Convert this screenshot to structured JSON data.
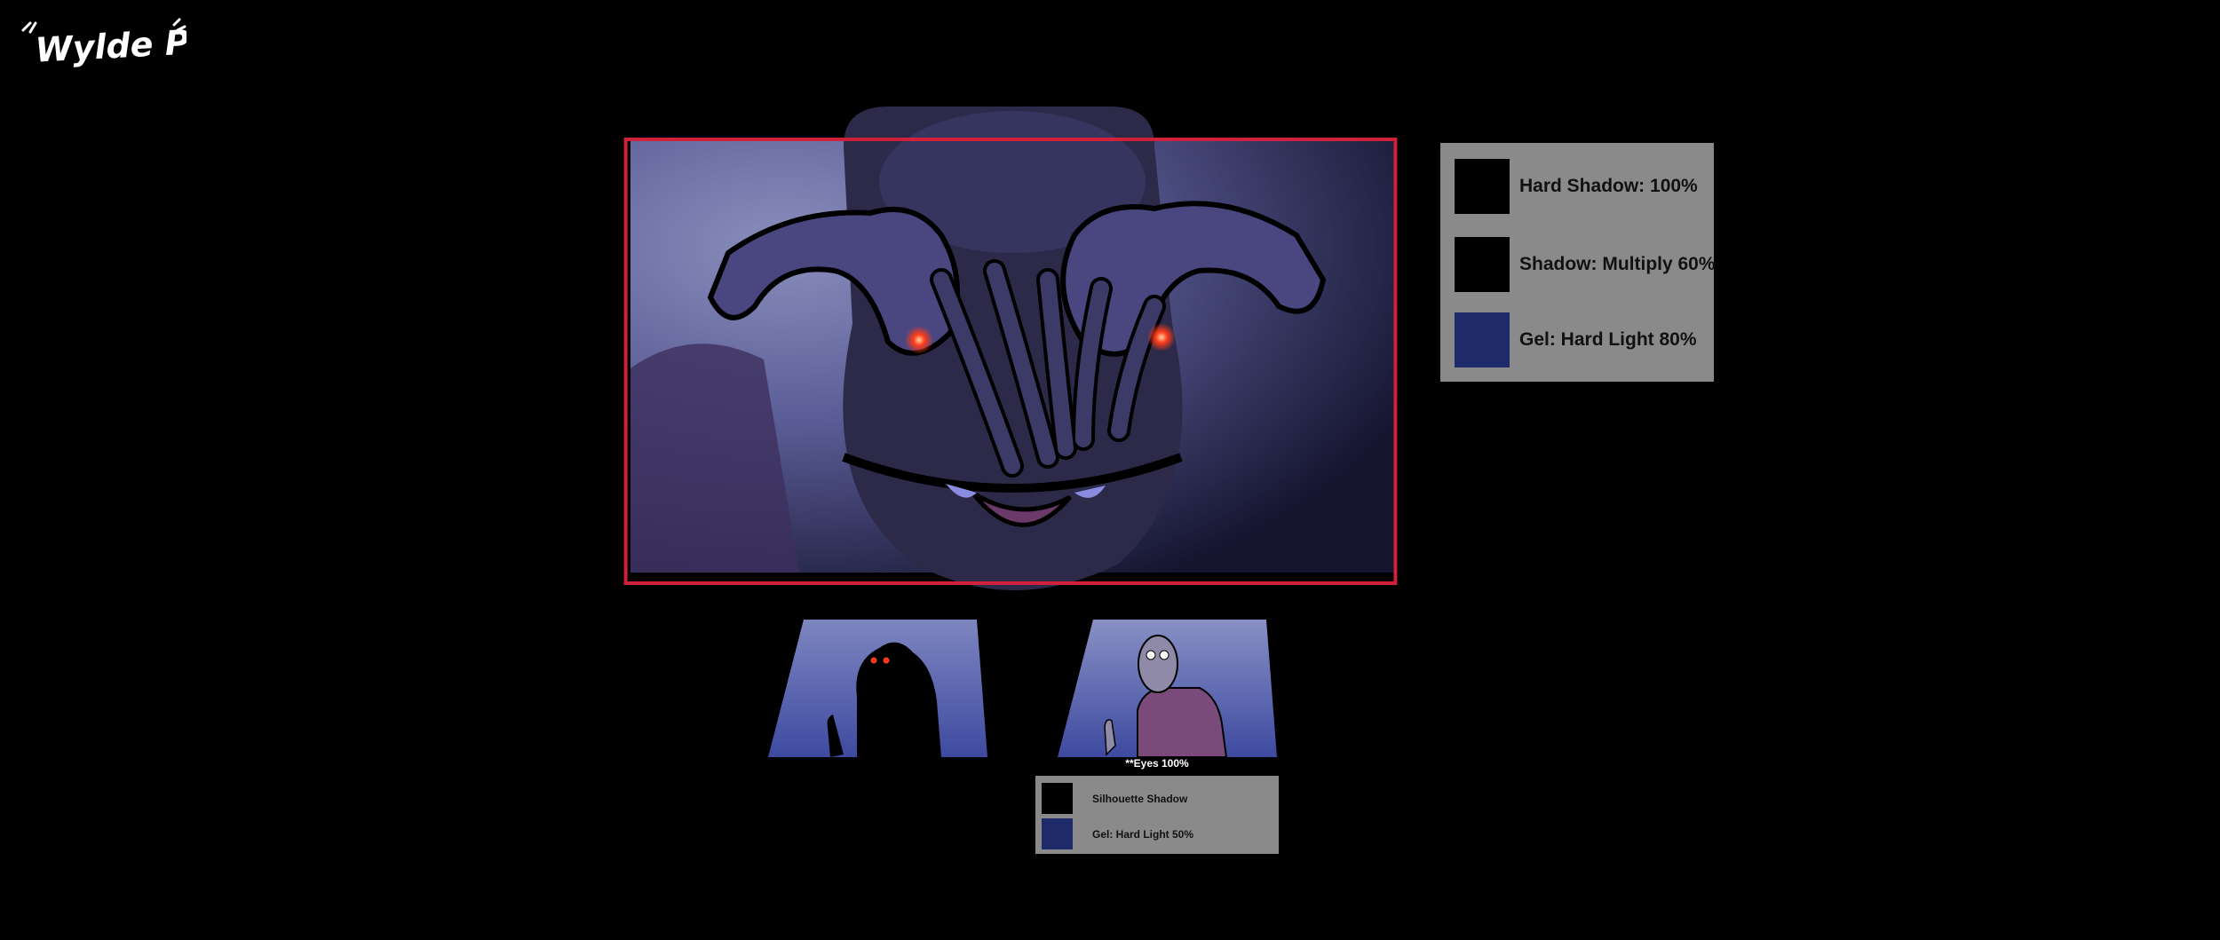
{
  "logo": {
    "text": "Wylde Pak"
  },
  "main_legend": {
    "items": [
      {
        "label": "Hard Shadow: 100%",
        "color": "#000000"
      },
      {
        "label": "Shadow: Multiply 60%",
        "color": "#000000"
      },
      {
        "label": "Gel: Hard Light 80%",
        "color": "#1f2a6b"
      }
    ]
  },
  "thumbnails": {
    "note": "**Eyes 100%"
  },
  "small_legend": {
    "items": [
      {
        "label": "Silhouette Shadow",
        "color": "#000000"
      },
      {
        "label": "Gel: Hard Light 50%",
        "color": "#1f2a6b"
      }
    ]
  },
  "colors": {
    "frame_border": "#d0203a",
    "panel_bg": "#8a8a8a",
    "eye_glow": "#ff3b1a"
  }
}
